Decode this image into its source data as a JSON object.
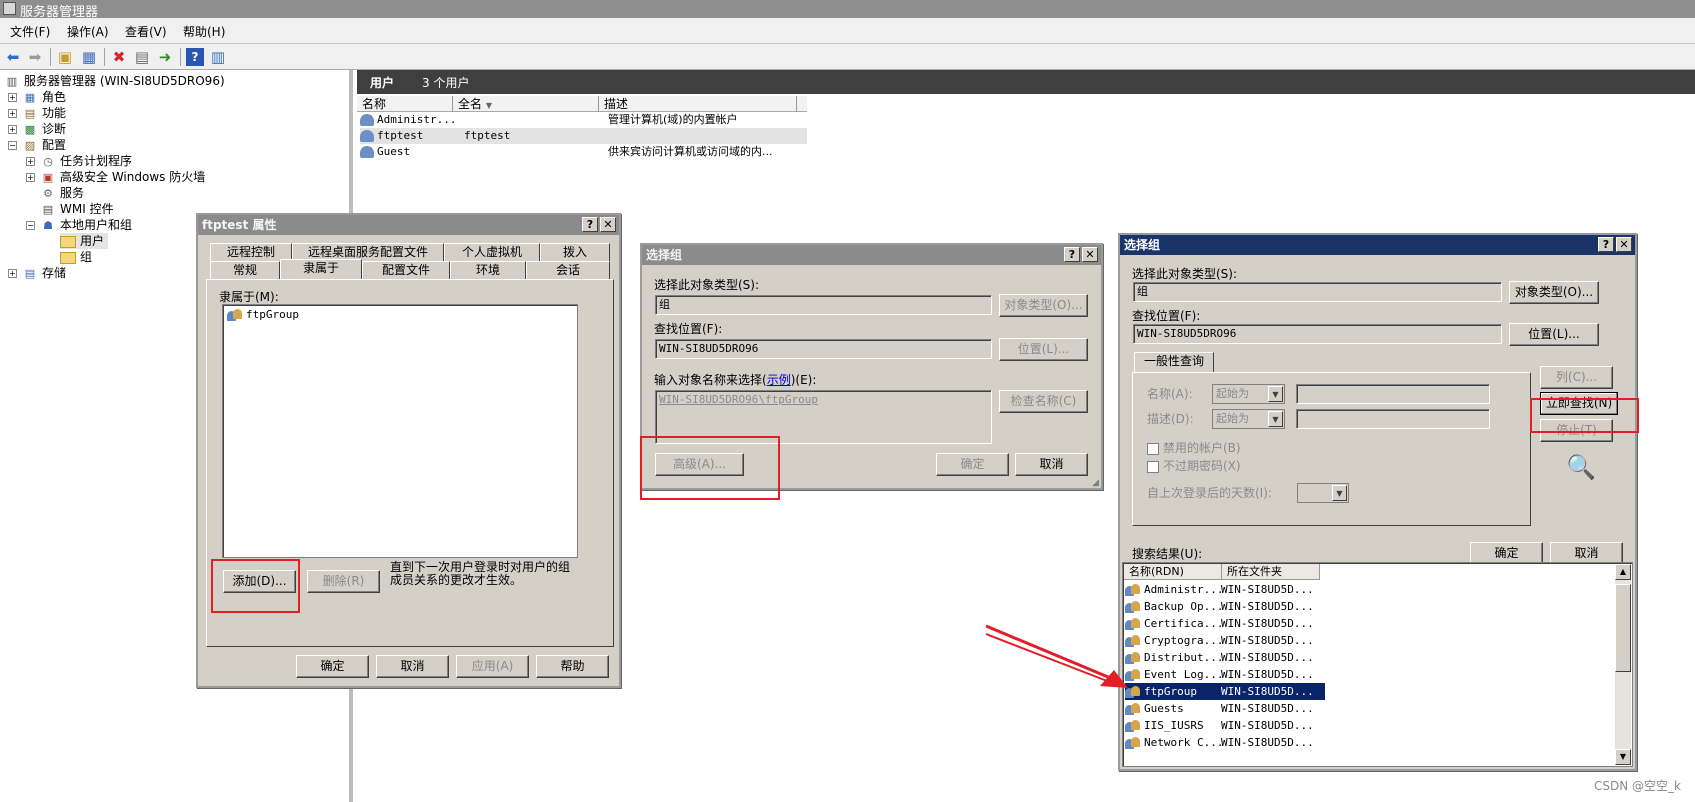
{
  "window": {
    "title": "服务器管理器"
  },
  "menu": [
    "文件(F)",
    "操作(A)",
    "查看(V)",
    "帮助(H)"
  ],
  "toolbar_icons": [
    "back-icon",
    "forward-icon",
    "up-folder-icon",
    "show-hide-tree-icon",
    "delete-icon",
    "properties-icon",
    "export-icon",
    "help-icon",
    "view-icon"
  ],
  "tree": {
    "root": "服务器管理器 (WIN-SI8UD5DRO96)",
    "roles": "角色",
    "features": "功能",
    "diagnostics": "诊断",
    "configuration": "配置",
    "task_scheduler": "任务计划程序",
    "firewall": "高级安全 Windows 防火墙",
    "services": "服务",
    "wmi": "WMI 控件",
    "local_users_groups": "本地用户和组",
    "users": "用户",
    "groups": "组",
    "storage": "存储"
  },
  "users_pane": {
    "title": "用户",
    "count": "3 个用户",
    "columns": [
      "名称",
      "全名",
      "描述"
    ],
    "rows": [
      {
        "name": "Administr...",
        "fullname": "",
        "desc": "管理计算机(域)的内置帐户"
      },
      {
        "name": "ftptest",
        "fullname": "ftptest",
        "desc": ""
      },
      {
        "name": "Guest",
        "fullname": "",
        "desc": "供来宾访问计算机或访问域的内..."
      }
    ]
  },
  "props_dialog": {
    "title": "ftptest 属性",
    "tabs_row1": [
      "远程控制",
      "远程桌面服务配置文件",
      "个人虚拟机",
      "拨入"
    ],
    "tabs_row2": [
      "常规",
      "隶属于",
      "配置文件",
      "环境",
      "会话"
    ],
    "member_of_label": "隶属于(M):",
    "member_item": "ftpGroup",
    "add_button": "添加(D)...",
    "remove_button": "删除(R)",
    "note": "直到下一次用户登录时对用户的组成员关系的更改才生效。",
    "ok": "确定",
    "cancel": "取消",
    "apply": "应用(A)",
    "help": "帮助"
  },
  "select_group_small": {
    "title": "选择组",
    "object_type_label": "选择此对象类型(S):",
    "object_type_value": "组",
    "object_types_button": "对象类型(O)...",
    "location_label": "查找位置(F):",
    "location_value": "WIN-SI8UD5DRO96",
    "locations_button": "位置(L)...",
    "enter_names_label_pre": "输入对象名称来选择(",
    "enter_names_link": "示例",
    "enter_names_label_post": ")(E):",
    "names_value": "WIN-SI8UD5DRO96\\ftpGroup",
    "check_names_button": "检查名称(C)",
    "advanced_button": "高级(A)...",
    "ok": "确定",
    "cancel": "取消"
  },
  "select_group_adv": {
    "title": "选择组",
    "object_type_label": "选择此对象类型(S):",
    "object_type_value": "组",
    "object_types_button": "对象类型(O)...",
    "location_label": "查找位置(F):",
    "location_value": "WIN-SI8UD5DRO96",
    "locations_button": "位置(L)...",
    "common_queries_tab": "一般性查询",
    "name_label": "名称(A):",
    "desc_label": "描述(D):",
    "starts_with": "起始为",
    "disabled_accounts": "禁用的帐户(B)",
    "non_expiring_pw": "不过期密码(X)",
    "days_since_logon": "自上次登录后的天数(I):",
    "columns_button": "列(C)...",
    "find_now_button": "立即查找(N)",
    "stop_button": "停止(T)",
    "ok": "确定",
    "cancel": "取消",
    "results_label": "搜索结果(U):",
    "results_columns": [
      "名称(RDN)",
      "所在文件夹"
    ],
    "results": [
      {
        "name": "Administr...",
        "folder": "WIN-SI8UD5D..."
      },
      {
        "name": "Backup Op...",
        "folder": "WIN-SI8UD5D..."
      },
      {
        "name": "Certifica...",
        "folder": "WIN-SI8UD5D..."
      },
      {
        "name": "Cryptogra...",
        "folder": "WIN-SI8UD5D..."
      },
      {
        "name": "Distribut...",
        "folder": "WIN-SI8UD5D..."
      },
      {
        "name": "Event Log...",
        "folder": "WIN-SI8UD5D..."
      },
      {
        "name": "ftpGroup",
        "folder": "WIN-SI8UD5D..."
      },
      {
        "name": "Guests",
        "folder": "WIN-SI8UD5D..."
      },
      {
        "name": "IIS_IUSRS",
        "folder": "WIN-SI8UD5D..."
      },
      {
        "name": "Network C...",
        "folder": "WIN-SI8UD5D..."
      }
    ],
    "selected_result": "ftpGroup"
  },
  "annotation_color": "#e21e26",
  "watermark": "CSDN @空空_k"
}
